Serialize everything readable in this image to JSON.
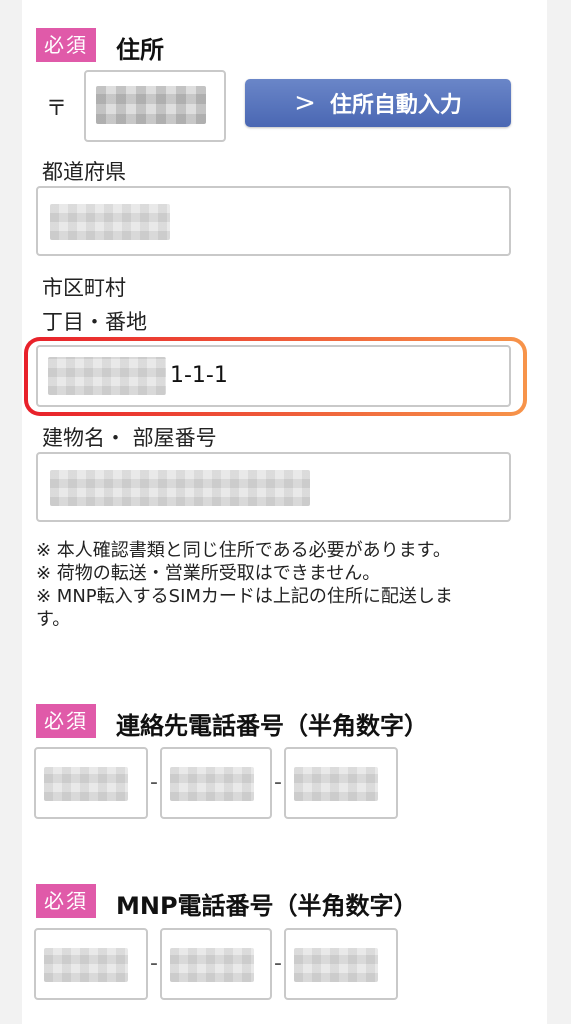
{
  "address": {
    "required_badge": "必須",
    "heading": "住所",
    "postal_mark": "〒",
    "auto_fill_button": "住所自動入力",
    "prefecture_label": "都道府県",
    "city_label": "市区町村",
    "street_label": "丁目・番地",
    "street_value_visible": "1-1-1",
    "building_label": "建物名・ 部屋番号",
    "notes": [
      "※ 本人確認書類と同じ住所である必要があります。",
      "※ 荷物の転送・営業所受取はできません。",
      "※ MNP転入するSIMカードは上記の住所に配送しま",
      "す。"
    ]
  },
  "contact_phone": {
    "required_badge": "必須",
    "heading": "連絡先電話番号（半角数字）",
    "separator": "-"
  },
  "mnp_phone": {
    "required_badge": "必須",
    "heading": "MNP電話番号（半角数字）",
    "separator": "-"
  },
  "colors": {
    "badge": "#e05aa9",
    "button": "#4a67b3",
    "highlight_start": "#e8202a",
    "highlight_end": "#f7944a"
  }
}
